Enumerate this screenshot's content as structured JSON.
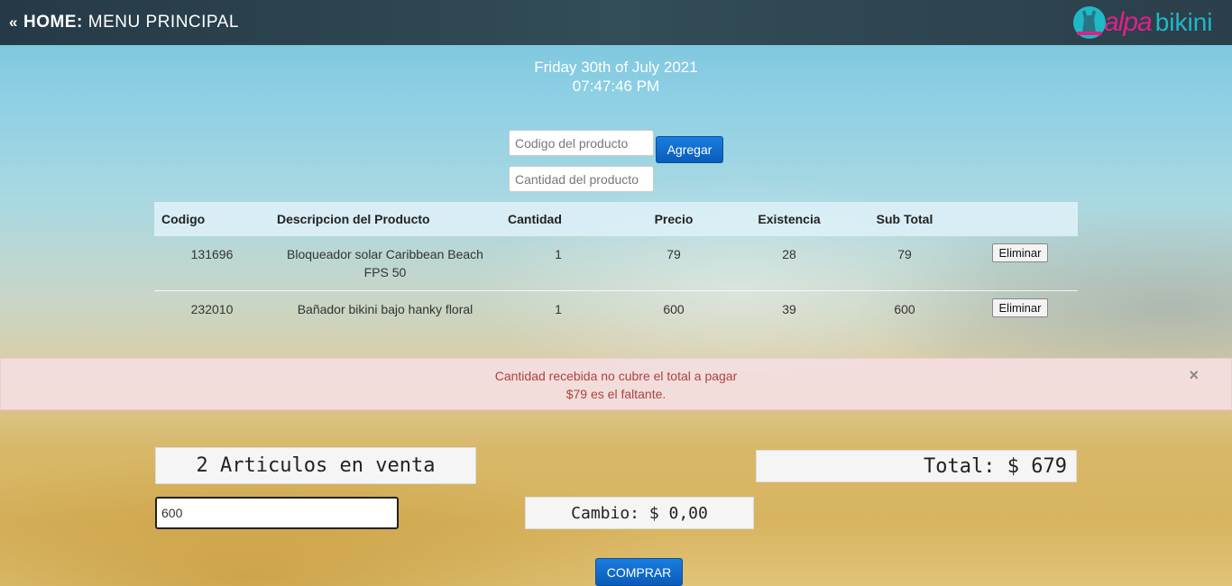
{
  "header": {
    "chevron": "«",
    "home": "HOME:",
    "menu": "MENU PRINCIPAL",
    "logo": {
      "icon": "llama-logo-icon",
      "word1": "alpa",
      "word2": "bikini"
    }
  },
  "datetime": {
    "date": "Friday 30th of July 2021",
    "time": "07:47:46 PM"
  },
  "form": {
    "code_placeholder": "Codigo del producto",
    "qty_placeholder": "Cantidad del producto",
    "add_label": "Agregar"
  },
  "table": {
    "headers": [
      "Codigo",
      "Descripcion del Producto",
      "Cantidad",
      "Precio",
      "Existencia",
      "Sub Total"
    ],
    "rows": [
      {
        "code": "131696",
        "desc": "Bloqueador solar Caribbean Beach FPS 50",
        "qty": "1",
        "price": "79",
        "stock": "28",
        "subtotal": "79",
        "action": "Eliminar"
      },
      {
        "code": "232010",
        "desc": "Bañador bikini bajo hanky floral",
        "qty": "1",
        "price": "600",
        "stock": "39",
        "subtotal": "600",
        "action": "Eliminar"
      }
    ]
  },
  "alert": {
    "line1": "Cantidad recebida no cubre el total a pagar",
    "line2": "$79 es el faltante.",
    "close": "×"
  },
  "summary": {
    "articles": "2 Articulos en venta",
    "total": "Total: $ 679",
    "amount_value": "600",
    "change": "Cambio: $ 0,00",
    "buy_label": "COMPRAR"
  },
  "colors": {
    "topbar": "#2b3f4a",
    "button_blue": "#0a6fd0",
    "alert_text": "#a94442",
    "alert_bg": "#f2dede",
    "logo_pink": "#e0208a",
    "logo_teal": "#1fb8c8"
  }
}
